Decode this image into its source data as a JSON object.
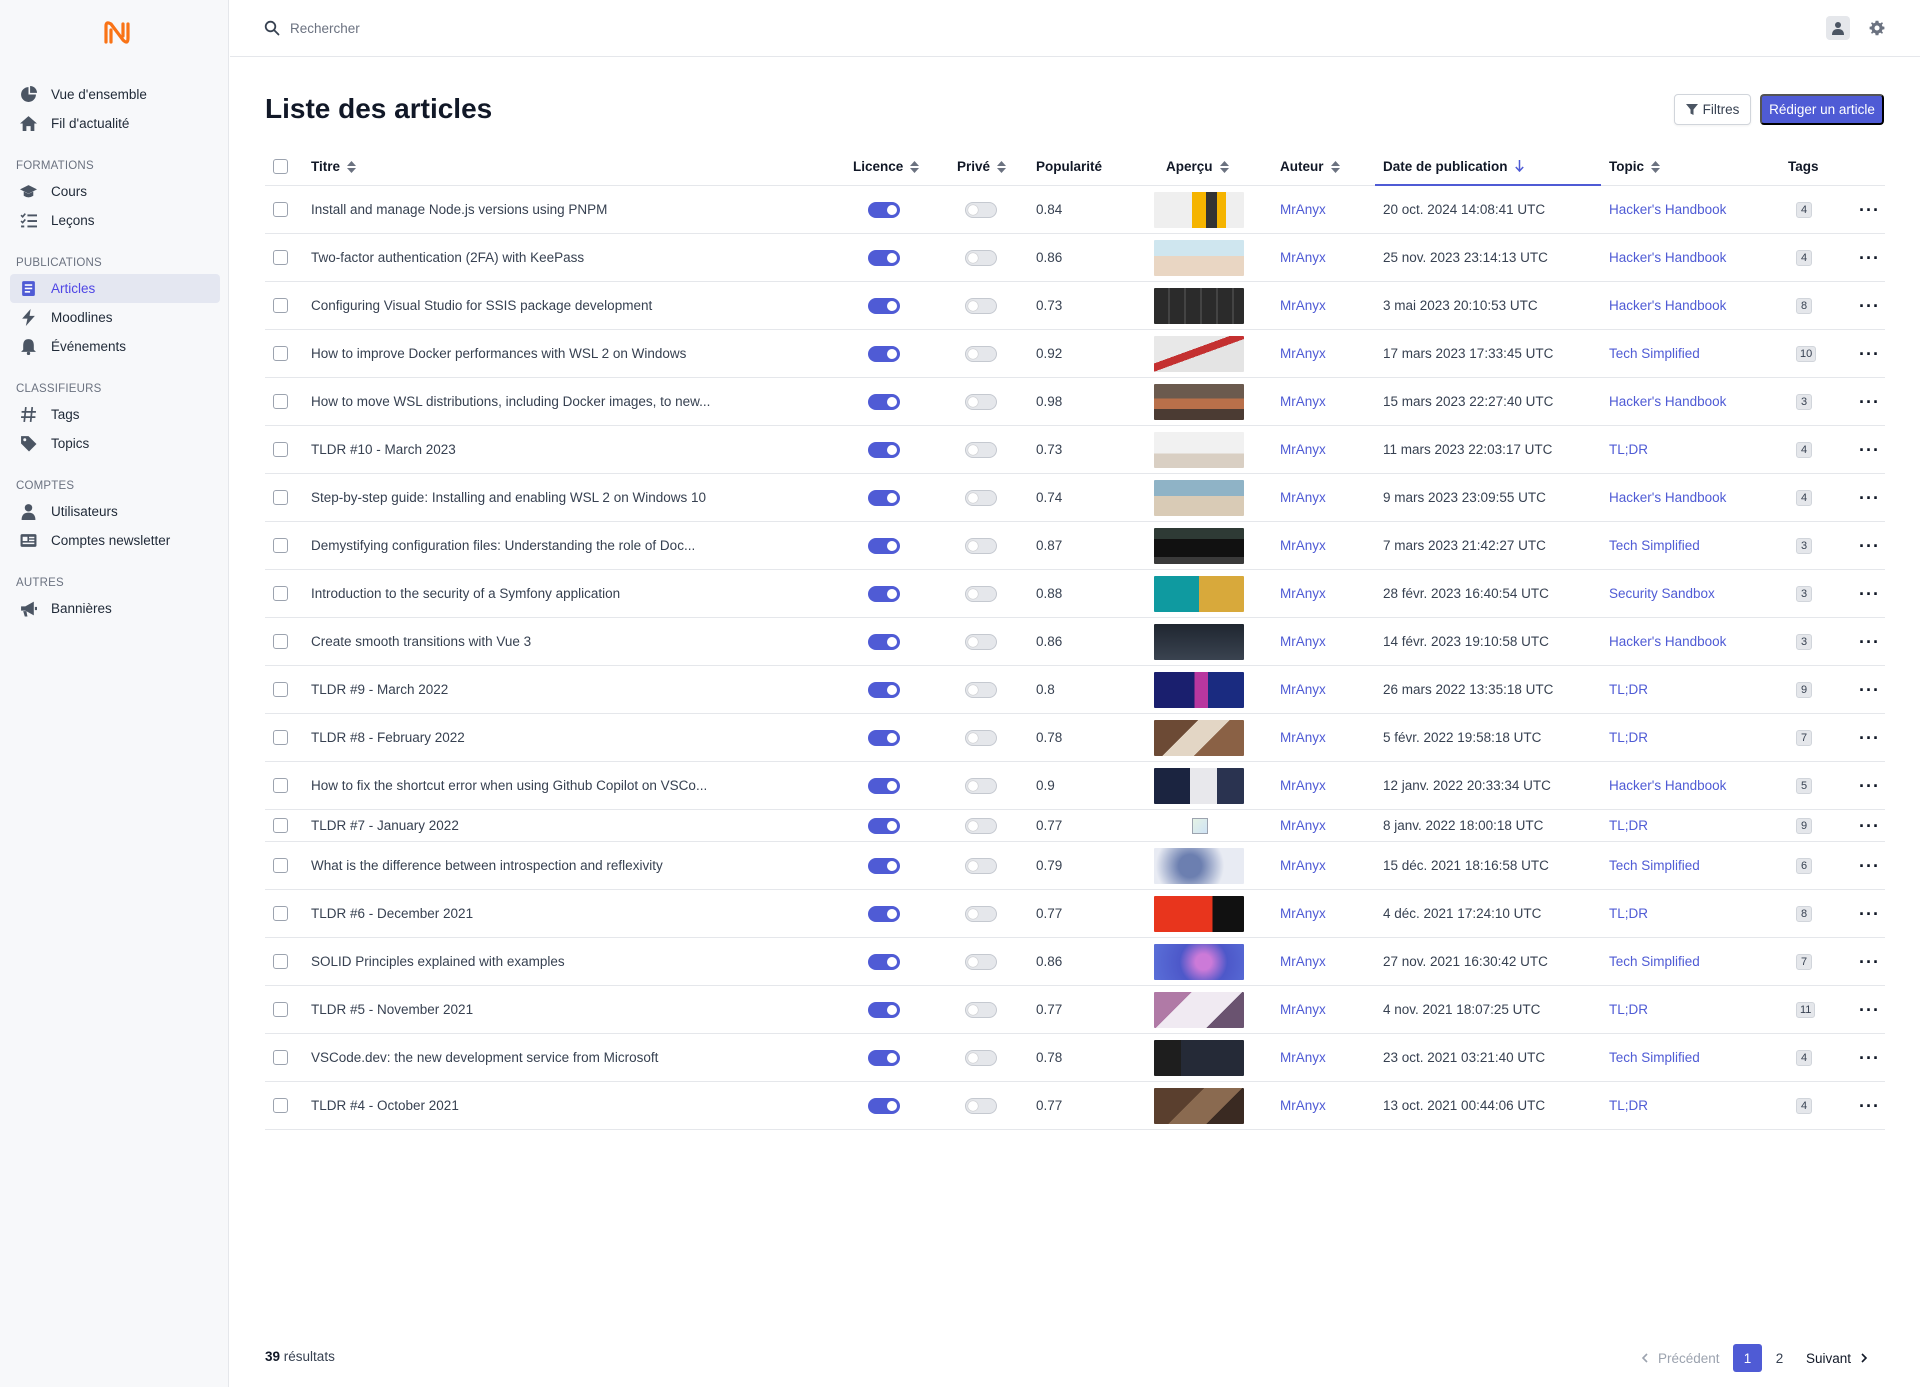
{
  "sidebar": {
    "items_top": [
      {
        "label": "Vue d'ensemble",
        "icon": "pie-chart-icon"
      },
      {
        "label": "Fil d'actualité",
        "icon": "home-icon"
      }
    ],
    "sections": [
      {
        "title": "FORMATIONS",
        "items": [
          {
            "label": "Cours",
            "icon": "graduation-cap-icon"
          },
          {
            "label": "Leçons",
            "icon": "list-check-icon"
          }
        ]
      },
      {
        "title": "PUBLICATIONS",
        "items": [
          {
            "label": "Articles",
            "icon": "article-icon",
            "active": true
          },
          {
            "label": "Moodlines",
            "icon": "bolt-icon"
          },
          {
            "label": "Événements",
            "icon": "bell-icon"
          }
        ]
      },
      {
        "title": "CLASSIFIEURS",
        "items": [
          {
            "label": "Tags",
            "icon": "hash-icon"
          },
          {
            "label": "Topics",
            "icon": "tag-icon"
          }
        ]
      },
      {
        "title": "COMPTES",
        "items": [
          {
            "label": "Utilisateurs",
            "icon": "user-icon"
          },
          {
            "label": "Comptes newsletter",
            "icon": "newspaper-icon"
          }
        ]
      },
      {
        "title": "AUTRES",
        "items": [
          {
            "label": "Bannières",
            "icon": "megaphone-icon"
          }
        ]
      }
    ]
  },
  "search": {
    "placeholder": "Rechercher"
  },
  "page": {
    "title": "Liste des articles",
    "filter_label": "Filtres",
    "new_label": "Rédiger un article"
  },
  "columns": {
    "title": "Titre",
    "license": "Licence",
    "private": "Privé",
    "popularity": "Popularité",
    "preview": "Aperçu",
    "author": "Auteur",
    "date": "Date de publication",
    "topic": "Topic",
    "tags": "Tags"
  },
  "rows": [
    {
      "title": "Install and manage Node.js versions using PNPM",
      "popularity": "0.84",
      "author": "MrAnyx",
      "date": "20 oct. 2024 14:08:41 UTC",
      "topic": "Hacker's Handbook",
      "tags": "4",
      "thumb": "pnpm"
    },
    {
      "title": "Two-factor authentication (2FA) with KeePass",
      "popularity": "0.86",
      "author": "MrAnyx",
      "date": "25 nov. 2023 23:14:13 UTC",
      "topic": "Hacker's Handbook",
      "tags": "4",
      "thumb": "beach"
    },
    {
      "title": "Configuring Visual Studio for SSIS package development",
      "popularity": "0.73",
      "author": "MrAnyx",
      "date": "3 mai 2023 20:10:53 UTC",
      "topic": "Hacker's Handbook",
      "tags": "8",
      "thumb": "keyboard"
    },
    {
      "title": "How to improve Docker performances with WSL 2 on Windows",
      "popularity": "0.92",
      "author": "MrAnyx",
      "date": "17 mars 2023 17:33:45 UTC",
      "topic": "Tech Simplified",
      "tags": "10",
      "thumb": "train"
    },
    {
      "title": "How to move WSL distributions, including Docker images, to new...",
      "popularity": "0.98",
      "author": "MrAnyx",
      "date": "15 mars 2023 22:27:40 UTC",
      "topic": "Hacker's Handbook",
      "tags": "3",
      "thumb": "room"
    },
    {
      "title": "TLDR #10 - March 2023",
      "popularity": "0.73",
      "author": "MrAnyx",
      "date": "11 mars 2023 22:03:17 UTC",
      "topic": "TL;DR",
      "tags": "4",
      "thumb": "desk"
    },
    {
      "title": "Step-by-step guide: Installing and enabling WSL 2 on Windows 10",
      "popularity": "0.74",
      "author": "MrAnyx",
      "date": "9 mars 2023 23:09:55 UTC",
      "topic": "Hacker's Handbook",
      "tags": "4",
      "thumb": "penguins"
    },
    {
      "title": "Demystifying configuration files: Understanding the role of Doc...",
      "popularity": "0.87",
      "author": "MrAnyx",
      "date": "7 mars 2023 21:42:27 UTC",
      "topic": "Tech Simplified",
      "tags": "3",
      "thumb": "setup"
    },
    {
      "title": "Introduction to the security of a Symfony application",
      "popularity": "0.88",
      "author": "MrAnyx",
      "date": "28 févr. 2023 16:40:54 UTC",
      "topic": "Security Sandbox",
      "tags": "3",
      "thumb": "camera"
    },
    {
      "title": "Create smooth transitions with Vue 3",
      "popularity": "0.86",
      "author": "MrAnyx",
      "date": "14 févr. 2023 19:10:58 UTC",
      "topic": "Hacker's Handbook",
      "tags": "3",
      "thumb": "dark"
    },
    {
      "title": "TLDR #9 - March 2022",
      "popularity": "0.8",
      "author": "MrAnyx",
      "date": "26 mars 2022 13:35:18 UTC",
      "topic": "TL;DR",
      "tags": "9",
      "thumb": "code"
    },
    {
      "title": "TLDR #8 - February 2022",
      "popularity": "0.78",
      "author": "MrAnyx",
      "date": "5 févr. 2022 19:58:18 UTC",
      "topic": "TL;DR",
      "tags": "7",
      "thumb": "team"
    },
    {
      "title": "How to fix the shortcut error when using Github Copilot on VSCo...",
      "popularity": "0.9",
      "author": "MrAnyx",
      "date": "12 janv. 2022 20:33:34 UTC",
      "topic": "Hacker's Handbook",
      "tags": "5",
      "thumb": "robot"
    },
    {
      "title": "TLDR #7 - January 2022",
      "popularity": "0.77",
      "author": "MrAnyx",
      "date": "8 janv. 2022 18:00:18 UTC",
      "topic": "TL;DR",
      "tags": "9",
      "thumb": "broken"
    },
    {
      "title": "What is the difference between introspection and reflexivity",
      "popularity": "0.79",
      "author": "MrAnyx",
      "date": "15 déc. 2021 18:16:58 UTC",
      "topic": "Tech Simplified",
      "tags": "6",
      "thumb": "crystals"
    },
    {
      "title": "TLDR #6 - December 2021",
      "popularity": "0.77",
      "author": "MrAnyx",
      "date": "4 déc. 2021 17:24:10 UTC",
      "topic": "TL;DR",
      "tags": "8",
      "thumb": "red"
    },
    {
      "title": "SOLID Principles explained with examples",
      "popularity": "0.86",
      "author": "MrAnyx",
      "date": "27 nov. 2021 16:30:42 UTC",
      "topic": "Tech Simplified",
      "tags": "7",
      "thumb": "purple"
    },
    {
      "title": "TLDR #5 - November 2021",
      "popularity": "0.77",
      "author": "MrAnyx",
      "date": "4 nov. 2021 18:07:25 UTC",
      "topic": "TL;DR",
      "tags": "11",
      "thumb": "laptop"
    },
    {
      "title": "VSCode.dev: the new development service from Microsoft",
      "popularity": "0.78",
      "author": "MrAnyx",
      "date": "23 oct. 2021 03:21:40 UTC",
      "topic": "Tech Simplified",
      "tags": "4",
      "thumb": "editor"
    },
    {
      "title": "TLDR #4 - October 2021",
      "popularity": "0.77",
      "author": "MrAnyx",
      "date": "13 oct. 2021 00:44:06 UTC",
      "topic": "TL;DR",
      "tags": "4",
      "thumb": "laptops"
    }
  ],
  "footer": {
    "count": "39",
    "count_label": "résultats",
    "prev": "Précédent",
    "page_current": "1",
    "page_2": "2",
    "next": "Suivant"
  },
  "colors": {
    "accent": "#4f5bd5",
    "logo": "#f97316"
  }
}
